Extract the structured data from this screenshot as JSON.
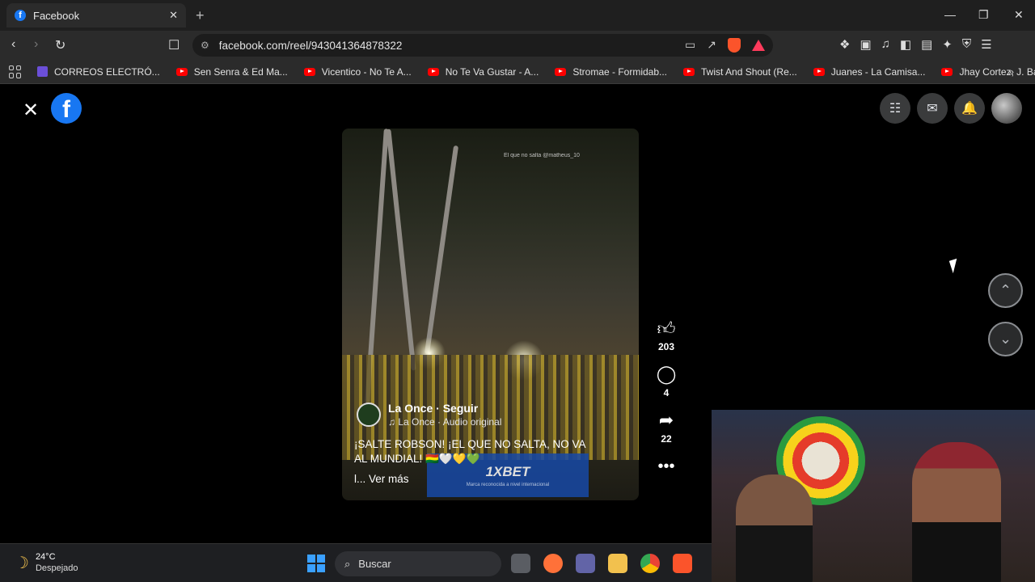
{
  "browser": {
    "tab_title": "Facebook",
    "tab_close": "✕",
    "new_tab": "+",
    "url": "facebook.com/reel/943041364878322",
    "window_controls": [
      "—",
      "❐",
      "✕"
    ]
  },
  "bookmarks": [
    {
      "label": "CORREOS ELECTRÓ...",
      "icon": "mail-icon"
    },
    {
      "label": "Sen Senra & Ed Ma...",
      "icon": "youtube-icon"
    },
    {
      "label": "Vicentico - No Te A...",
      "icon": "youtube-icon"
    },
    {
      "label": "No Te Va Gustar - A...",
      "icon": "youtube-icon"
    },
    {
      "label": "Stromae - Formidab...",
      "icon": "youtube-icon"
    },
    {
      "label": "Twist And Shout (Re...",
      "icon": "youtube-icon"
    },
    {
      "label": "Juanes - La Camisa...",
      "icon": "youtube-icon"
    },
    {
      "label": "Jhay Cortez, J. Balvi...",
      "icon": "youtube-icon"
    }
  ],
  "reel": {
    "watermark": "El que no salta @matheus_10",
    "owner_name": "La Once",
    "follow": "· Seguir",
    "audio": "La Once · Audio original",
    "caption": "¡SALTE ROBSON! ¡EL QUE NO SALTA, NO VA AL MUNDIAL! 🇧🇴🤍💛💚",
    "ver_mas": "l... Ver más",
    "ad_brand": "1XBET",
    "ad_tagline": "Marca reconocida a nivel internacional"
  },
  "actions": {
    "likes": "203",
    "comments": "4",
    "shares": "22"
  },
  "taskbar": {
    "temperature": "24°C",
    "weather": "Despejado",
    "search_placeholder": "Buscar"
  },
  "colors": {
    "facebook_blue": "#1877f2",
    "brave_orange": "#fb542b"
  }
}
